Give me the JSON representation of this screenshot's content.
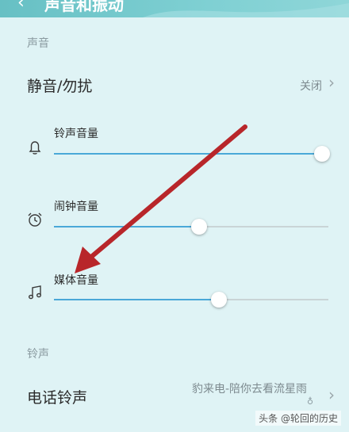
{
  "header": {
    "back_icon": "back-chevron-icon",
    "title": "声音和振动"
  },
  "sections": {
    "sound_label": "声音",
    "ringtone_label": "铃声"
  },
  "mute": {
    "label": "静音/勿扰",
    "value": "关闭"
  },
  "sliders": [
    {
      "label": "铃声音量",
      "icon": "bell-icon",
      "level": 1.0
    },
    {
      "label": "闹钟音量",
      "icon": "alarm-clock-icon",
      "level": 0.53
    },
    {
      "label": "媒体音量",
      "icon": "music-note-icon",
      "level": 0.6
    }
  ],
  "phone_ringtone": {
    "label": "电话铃声",
    "value": "豹来电-陪你去看流星雨"
  },
  "watermark": "头条 @轮回的历史",
  "colors": {
    "accent": "#4aa8d8",
    "background": "#dff3f5",
    "arrow": "#c0282a"
  }
}
